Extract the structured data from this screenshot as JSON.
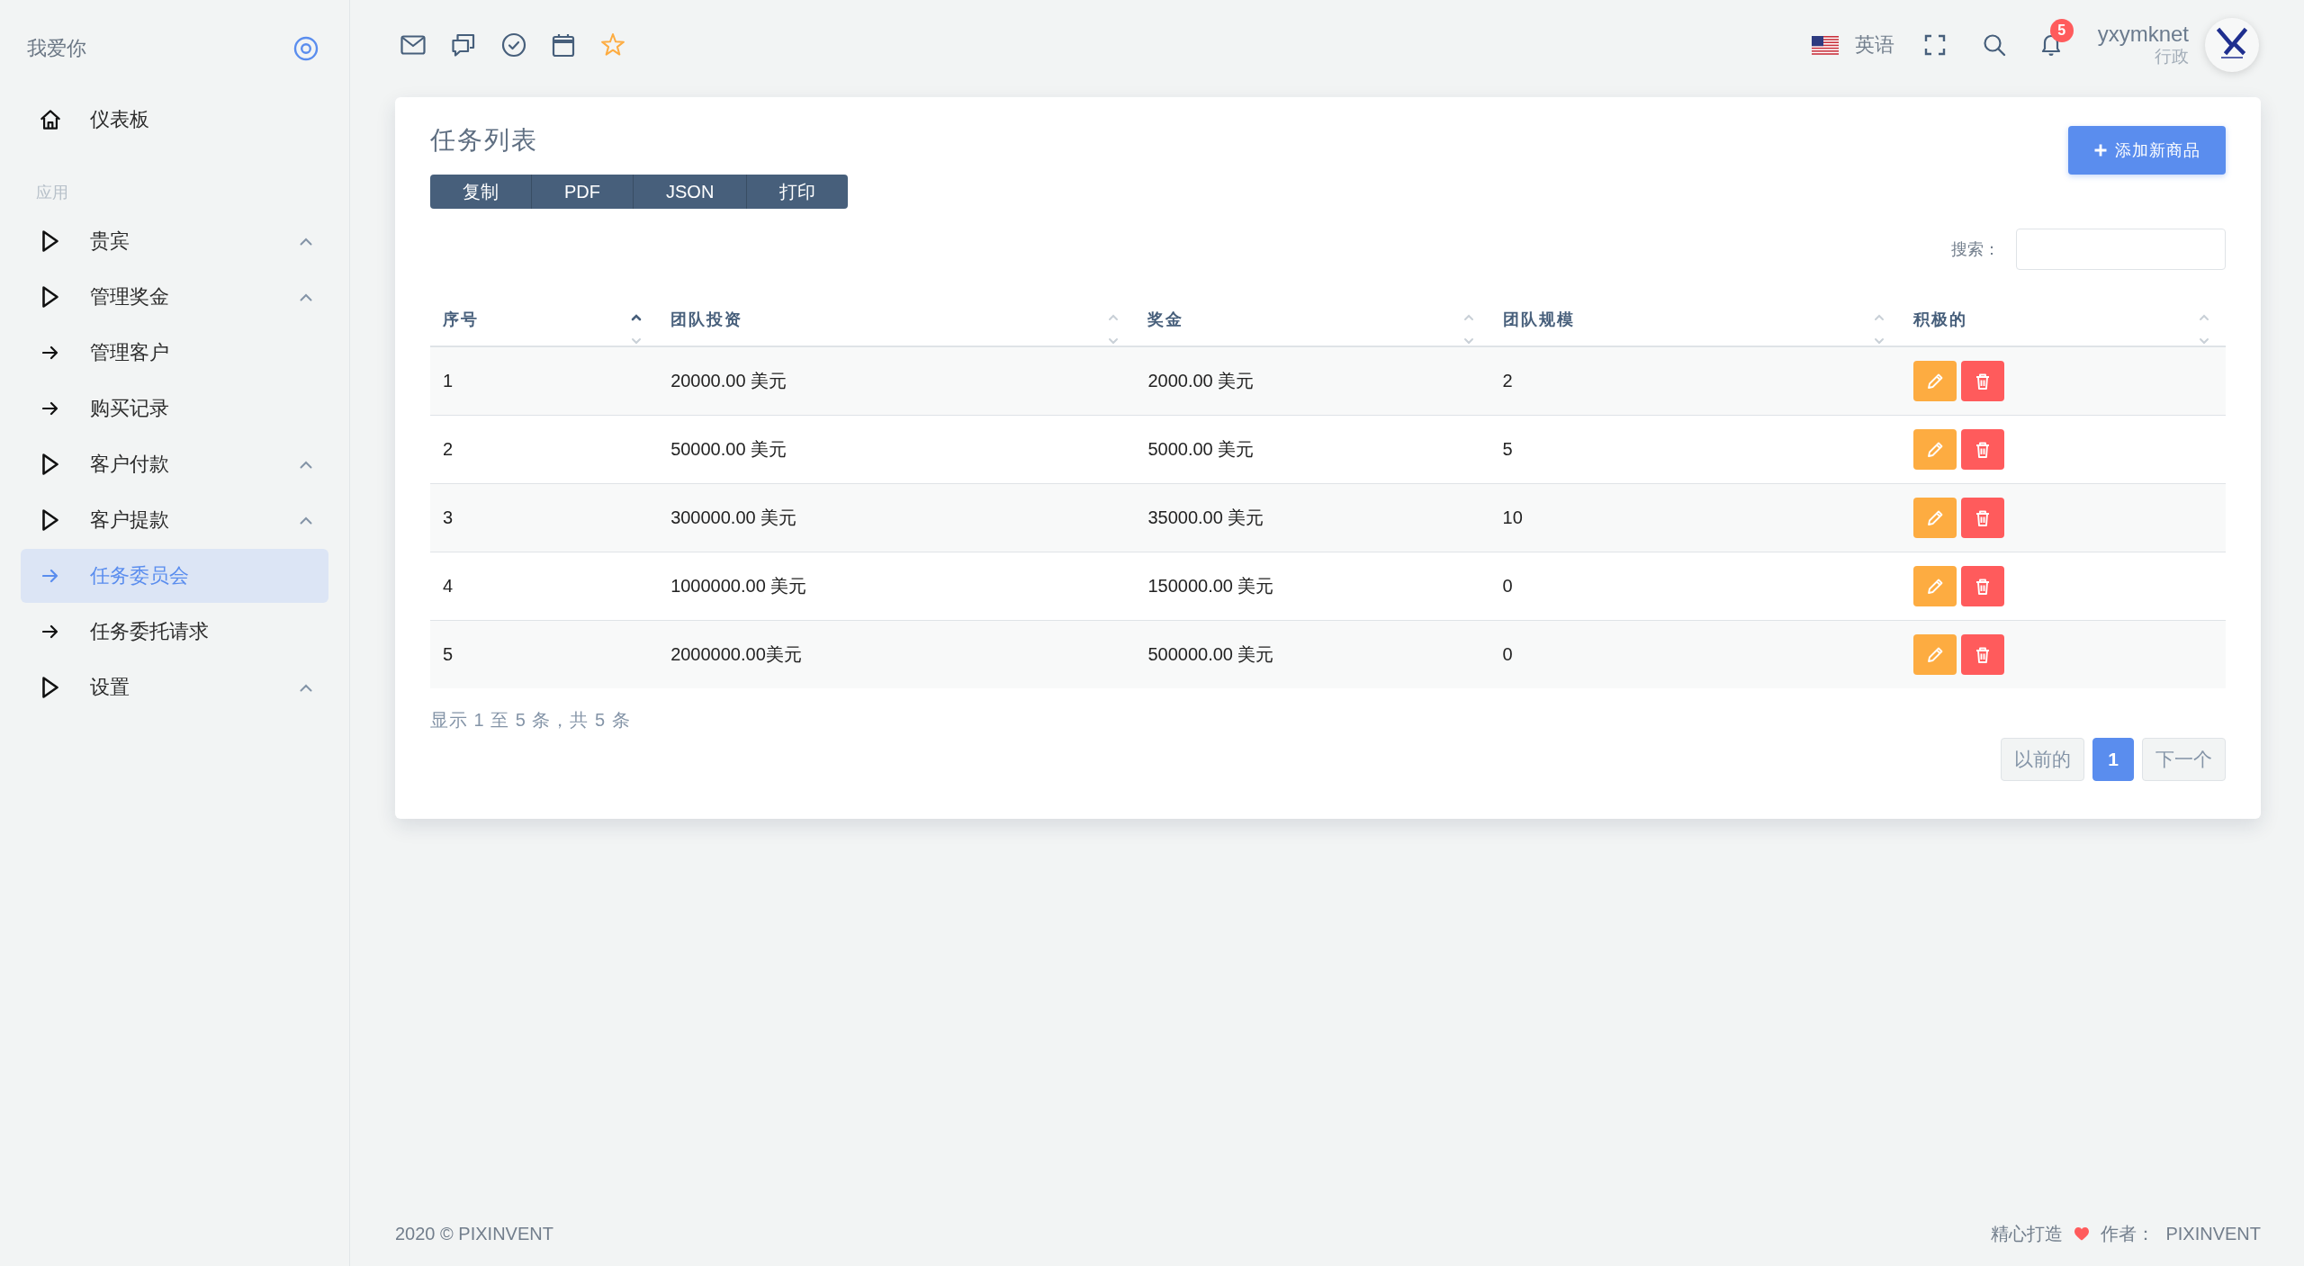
{
  "sidebar": {
    "brand": "我爱你",
    "dashboard": {
      "label": "仪表板",
      "selected": false
    },
    "section": "应用",
    "items": [
      {
        "label": "贵宾",
        "kind": "group",
        "selected": false
      },
      {
        "label": "管理奖金",
        "kind": "group",
        "selected": false
      },
      {
        "label": "管理客户",
        "kind": "link",
        "selected": false
      },
      {
        "label": "购买记录",
        "kind": "link",
        "selected": false
      },
      {
        "label": "客户付款",
        "kind": "group",
        "selected": false
      },
      {
        "label": "客户提款",
        "kind": "group",
        "selected": false
      },
      {
        "label": "任务委员会",
        "kind": "link",
        "selected": true
      },
      {
        "label": "任务委托请求",
        "kind": "link",
        "selected": false
      },
      {
        "label": "设置",
        "kind": "group",
        "selected": false
      }
    ]
  },
  "topbar": {
    "language": "英语",
    "notifications": "5",
    "user": {
      "name": "yxymknet",
      "role": "行政"
    }
  },
  "card": {
    "title": "任务列表",
    "export_buttons": [
      "复制",
      "PDF",
      "JSON",
      "打印"
    ],
    "add_button": "添加新商品",
    "search": {
      "label": "搜索："
    },
    "table": {
      "columns": [
        {
          "label": "序号",
          "sorted": true
        },
        {
          "label": "团队投资",
          "sorted": false
        },
        {
          "label": "奖金",
          "sorted": false
        },
        {
          "label": "团队规模",
          "sorted": false
        },
        {
          "label": "积极的",
          "sorted": false
        }
      ],
      "rows": [
        [
          "1",
          "20000.00 美元",
          "2000.00 美元",
          "2"
        ],
        [
          "2",
          "50000.00 美元",
          "5000.00 美元",
          "5"
        ],
        [
          "3",
          "300000.00 美元",
          "35000.00 美元",
          "10"
        ],
        [
          "4",
          "1000000.00 美元",
          "150000.00 美元",
          "0"
        ],
        [
          "5",
          "2000000.00美元",
          "500000.00 美元",
          "0"
        ]
      ]
    },
    "info": "显示 1 至 5 条，共 5 条",
    "pagination": {
      "prev": "以前的",
      "pages": [
        {
          "label": "1",
          "selected": true
        }
      ],
      "next": "下一个"
    }
  },
  "footer": {
    "copyright": "2020 © PIXINVENT",
    "made_with": "精心打造",
    "by": "作者：",
    "author": "PIXINVENT"
  }
}
